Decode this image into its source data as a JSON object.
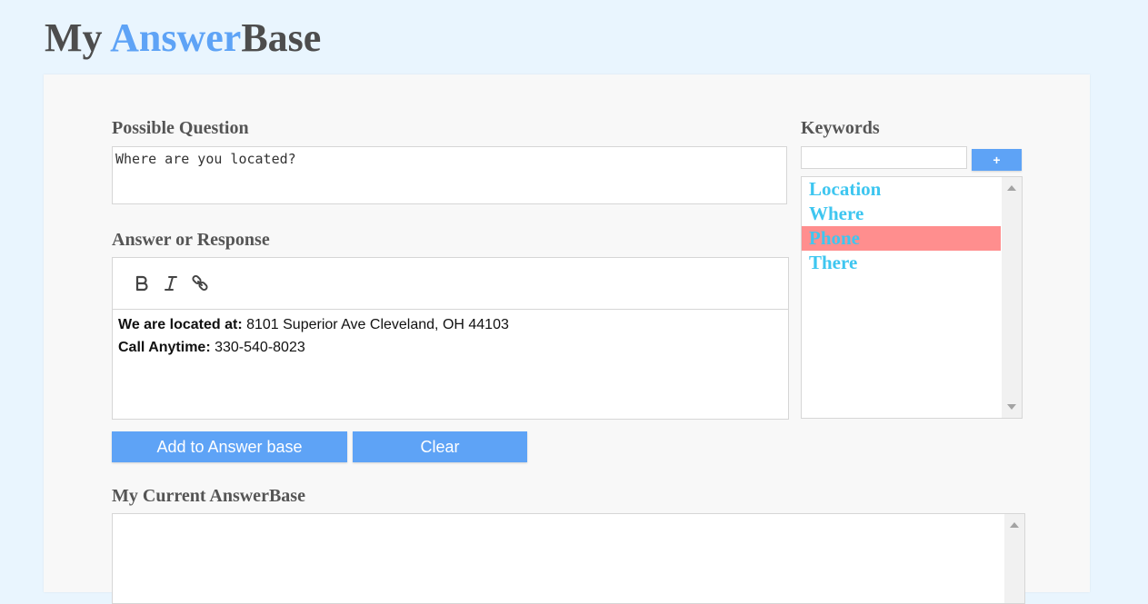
{
  "header": {
    "title_part1": "My ",
    "title_part2": "Answer",
    "title_part3": "Base"
  },
  "question": {
    "label": "Possible Question",
    "value": "Where are you located?"
  },
  "answer": {
    "label": "Answer or Response",
    "toolbar": {
      "bold": "bold-icon",
      "italic": "italic-icon",
      "link": "link-icon"
    },
    "lines": [
      {
        "bold": "We are located at:",
        "text": " 8101 Superior Ave Cleveland, OH 44103"
      },
      {
        "bold": "Call Anytime:",
        "text": " 330-540-8023"
      }
    ]
  },
  "buttons": {
    "add": "Add to Answer base",
    "clear": "Clear"
  },
  "keywords": {
    "label": "Keywords",
    "input_value": "",
    "add_label": "+",
    "items": [
      "Location",
      "Where",
      "Phone",
      "There"
    ],
    "selected_index": 2
  },
  "current": {
    "label": "My Current AnswerBase"
  },
  "colors": {
    "accent": "#5ea3f6",
    "keyword": "#3ec6f0",
    "selected": "#ff8e8e",
    "background": "#e9f5fe"
  }
}
